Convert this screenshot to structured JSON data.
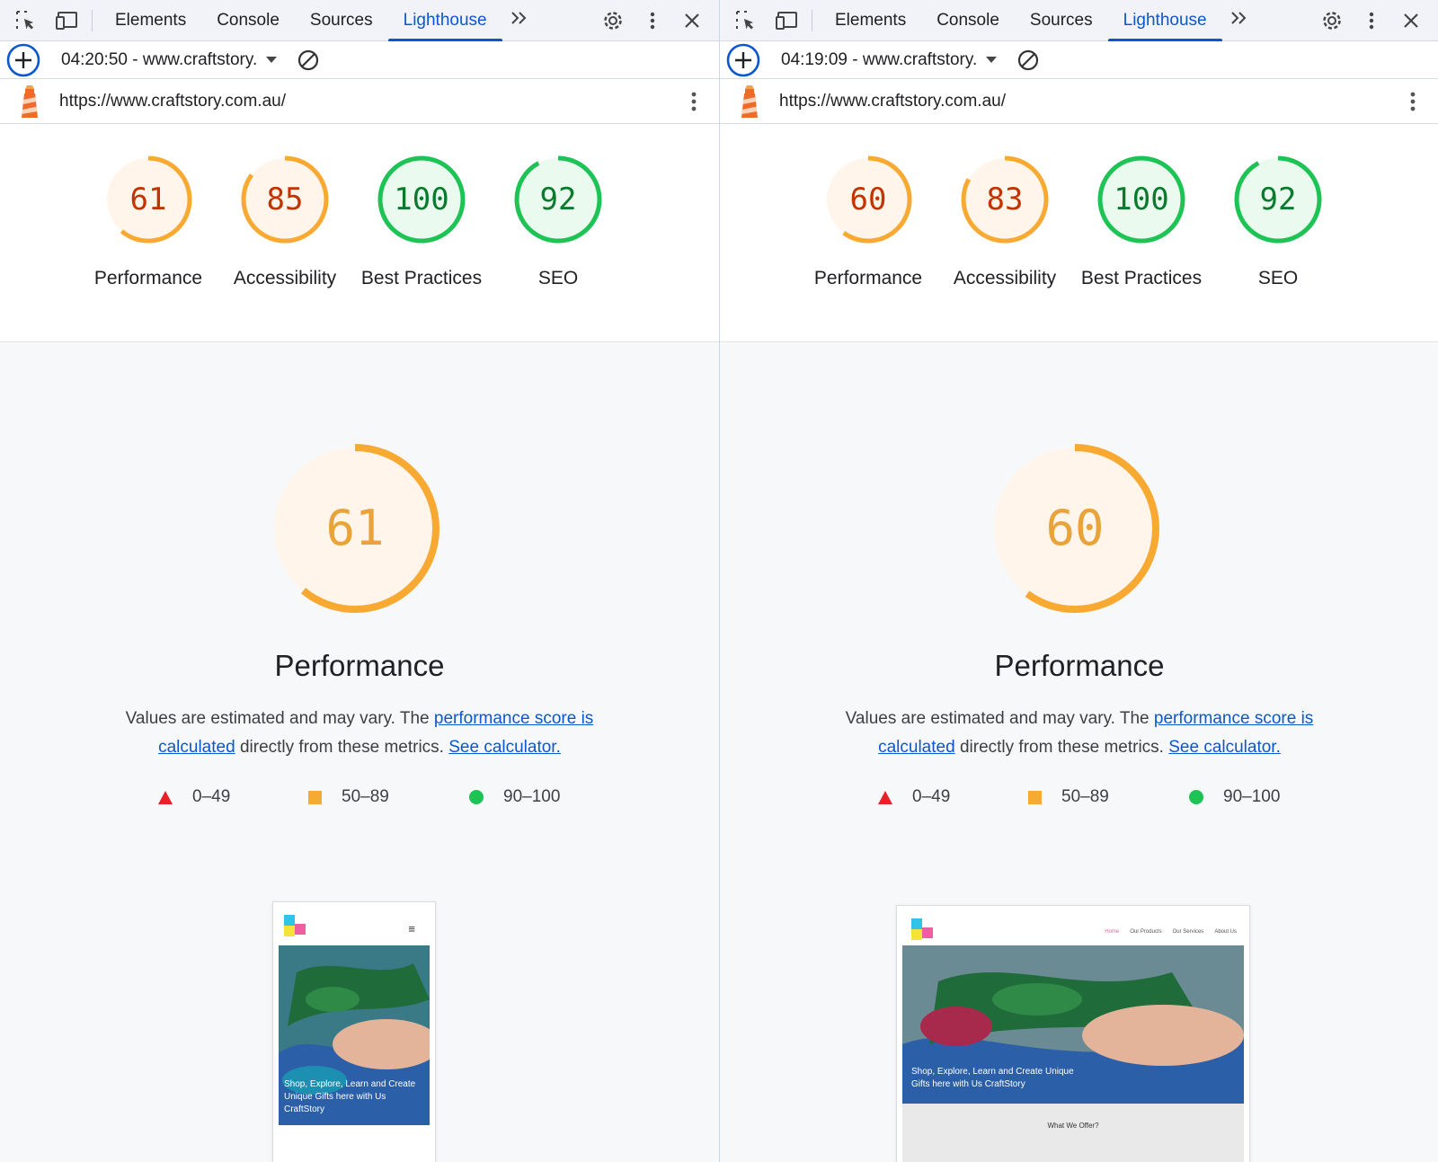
{
  "panels": [
    {
      "tabs": {
        "elements": "Elements",
        "console": "Console",
        "sources": "Sources",
        "lighthouse": "Lighthouse"
      },
      "report_select": "04:20:50 - www.craftstory.",
      "url": "https://www.craftstory.com.au/",
      "gauges": [
        {
          "label": "Performance",
          "score": "61",
          "value": 61,
          "status": "average"
        },
        {
          "label": "Accessibility",
          "score": "85",
          "value": 85,
          "status": "average"
        },
        {
          "label": "Best Practices",
          "score": "100",
          "value": 100,
          "status": "pass"
        },
        {
          "label": "SEO",
          "score": "92",
          "value": 92,
          "status": "pass"
        }
      ],
      "performance": {
        "score": "61",
        "value": 61,
        "title": "Performance",
        "desc_prefix": "Values are estimated and may vary. The ",
        "desc_link1": "performance score is calculated",
        "desc_middle": " directly from these metrics. ",
        "desc_link2": "See calculator."
      },
      "legend": {
        "fail": "0–49",
        "average": "50–89",
        "pass": "90–100"
      },
      "screenshot": {
        "caption": "Shop, Explore, Learn and Create Unique Gifts here with Us CraftStory",
        "nav": [],
        "menu_icon": "≡",
        "section_heading": ""
      }
    },
    {
      "tabs": {
        "elements": "Elements",
        "console": "Console",
        "sources": "Sources",
        "lighthouse": "Lighthouse"
      },
      "report_select": "04:19:09 - www.craftstory.",
      "url": "https://www.craftstory.com.au/",
      "gauges": [
        {
          "label": "Performance",
          "score": "60",
          "value": 60,
          "status": "average"
        },
        {
          "label": "Accessibility",
          "score": "83",
          "value": 83,
          "status": "average"
        },
        {
          "label": "Best Practices",
          "score": "100",
          "value": 100,
          "status": "pass"
        },
        {
          "label": "SEO",
          "score": "92",
          "value": 92,
          "status": "pass"
        }
      ],
      "performance": {
        "score": "60",
        "value": 60,
        "title": "Performance",
        "desc_prefix": "Values are estimated and may vary. The ",
        "desc_link1": "performance score is calculated",
        "desc_middle": " directly from these metrics. ",
        "desc_link2": "See calculator."
      },
      "legend": {
        "fail": "0–49",
        "average": "50–89",
        "pass": "90–100"
      },
      "screenshot": {
        "caption": "Shop, Explore, Learn and Create Unique Gifts here with Us CraftStory",
        "nav": [
          "Home",
          "Our Products",
          "Our Services",
          "About Us"
        ],
        "menu_icon": "",
        "section_heading": "What We Offer?"
      }
    }
  ],
  "colors": {
    "accent": "#0b57d0",
    "average_fg": "#c33300",
    "average_arc": "#f8a932",
    "average_bg": "#fff5ea",
    "pass_fg": "#0a7a2c",
    "pass_arc": "#1ec356",
    "pass_bg": "#eafaef",
    "fail": "#e8202a"
  },
  "icons": [
    "inspect-element-icon",
    "device-toolbar-icon",
    "more-tabs-icon",
    "settings-icon",
    "kebab-menu-icon",
    "close-icon",
    "add-report-icon",
    "clear-icon",
    "lighthouse-logo-icon"
  ]
}
